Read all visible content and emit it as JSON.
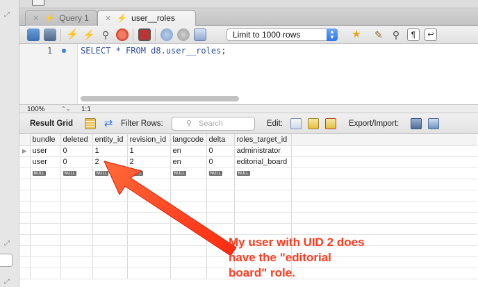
{
  "tabs": [
    {
      "label": "Query 1",
      "close": "✕",
      "active": false
    },
    {
      "label": "user__roles",
      "close": "✕",
      "active": true
    }
  ],
  "toolbar": {
    "limit_value": "Limit to 1000 rows",
    "icons": [
      "open-folder-icon",
      "save-icon",
      "execute-icon",
      "execute-current-icon",
      "explain-icon",
      "stop-icon",
      "toggle-autocommit-icon",
      "commit-icon",
      "rollback-icon",
      "toggle-inspector-icon",
      "bookmark-star-icon",
      "beautify-brush-icon",
      "find-icon",
      "invisible-chars-icon",
      "wrap-lines-icon"
    ]
  },
  "editor": {
    "line_number": "1",
    "sql": "SELECT * FROM d8.user__roles;"
  },
  "status": {
    "zoom": "100%",
    "stepper": "⌃⌄",
    "cursor": "1:1"
  },
  "result_toolbar": {
    "result_grid_label": "Result Grid",
    "filter_label": "Filter Rows:",
    "search_placeholder": "Search",
    "edit_label": "Edit:",
    "export_label": "Export/Import:"
  },
  "grid": {
    "columns": [
      "bundle",
      "deleted",
      "entity_id",
      "revision_id",
      "langcode",
      "delta",
      "roles_target_id"
    ],
    "rows": [
      [
        "user",
        "0",
        "1",
        "1",
        "en",
        "0",
        "administrator"
      ],
      [
        "user",
        "0",
        "2",
        "2",
        "en",
        "0",
        "editorial_board"
      ],
      [
        "NULL",
        "NULL",
        "NULL",
        "NULL",
        "NULL",
        "NULL",
        "NULL"
      ]
    ],
    "row_marker": "▶"
  },
  "annotation": {
    "lines": [
      "My user with UID 2 does",
      "have the \"editorial",
      "board\" role."
    ],
    "color": "#ff3b1f"
  },
  "colors": {
    "accent_blue": "#2f76e4",
    "sql_text": "#2f4c9b"
  }
}
